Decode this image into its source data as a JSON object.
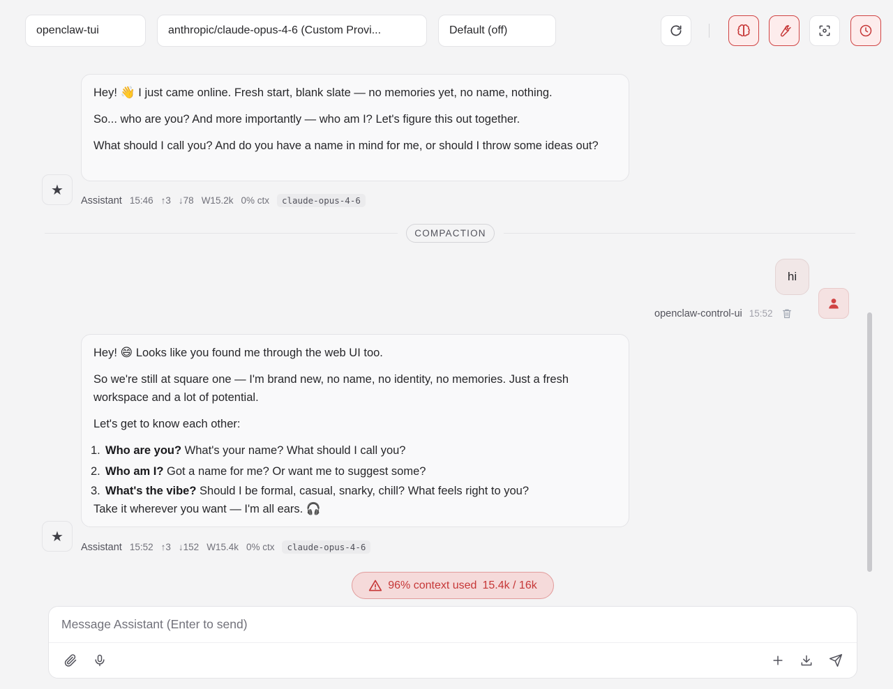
{
  "toolbar": {
    "session_value": "openclaw-tui",
    "model_value": "anthropic/claude-opus-4-6 (Custom Provi...",
    "thinking_value": "Default (off)",
    "buttons": [
      "refresh-icon",
      "brain-icon",
      "wrench-icon",
      "focus-icon",
      "clock-icon"
    ]
  },
  "messages": [
    {
      "role": "assistant",
      "paragraphs": {
        "p1_pre": "Hey! ",
        "p1_emoji": "👋",
        "p1_post": " I just came online. Fresh start, blank slate — no memories yet, no name, nothing.",
        "p2": "So... who are you? And more importantly — who am I? Let's figure this out together.",
        "p3": "What should I call you? And do you have a name in mind for me, or should I throw some ideas out?"
      },
      "meta": {
        "sender": "Assistant",
        "time": "15:46",
        "up": "↑3",
        "down": "↓78",
        "window": "W15.2k",
        "ctx": "0% ctx",
        "model": "claude-opus-4-6"
      }
    },
    {
      "role": "user",
      "text": "hi",
      "meta": {
        "sender": "openclaw-control-ui",
        "time": "15:52"
      }
    },
    {
      "role": "assistant",
      "paragraphs": {
        "p1_pre": "Hey! ",
        "p1_emoji": "😄",
        "p1_post": " Looks like you found me through the web UI too.",
        "p2": "So we're still at square one — I'm brand new, no name, no identity, no memories. Just a fresh workspace and a lot of potential.",
        "p3": "Let's get to know each other:",
        "list": [
          {
            "num": "1.",
            "bold": "Who are you?",
            "rest": " What's your name? What should I call you?"
          },
          {
            "num": "2.",
            "bold": "Who am I?",
            "rest": " Got a name for me? Or want me to suggest some?"
          },
          {
            "num": "3.",
            "bold": "What's the vibe?",
            "rest": " Should I be formal, casual, snarky, chill? What feels right to you?"
          }
        ],
        "closing_text": "Take it wherever you want — I'm all ears. ",
        "closing_emoji": "🎧"
      },
      "meta": {
        "sender": "Assistant",
        "time": "15:52",
        "up": "↑3",
        "down": "↓152",
        "window": "W15.4k",
        "ctx": "0% ctx",
        "model": "claude-opus-4-6"
      }
    }
  ],
  "divider": {
    "label": "COMPACTION"
  },
  "context_warning": {
    "percent_text": "96% context used",
    "usage_text": "15.4k / 16k",
    "color": "#c63737"
  },
  "composer": {
    "placeholder": "Message Assistant (Enter to send)",
    "value": ""
  },
  "colors": {
    "accent": "#d04444",
    "background": "#f4f4f5"
  }
}
